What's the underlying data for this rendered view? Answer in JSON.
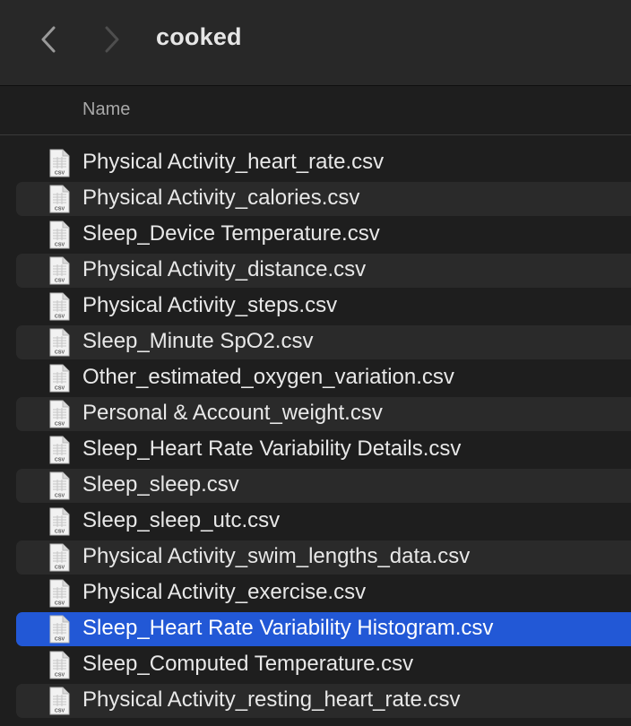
{
  "window": {
    "folder_title": "cooked"
  },
  "toolbar": {
    "back_icon": "chevron-left-icon",
    "forward_icon": "chevron-right-icon"
  },
  "columns": {
    "name_header": "Name"
  },
  "colors": {
    "background": "#1e1e1e",
    "toolbar": "#282828",
    "alt_row": "#2a2a2a",
    "selection": "#2258d6",
    "text": "#e8e8e8"
  },
  "files": [
    {
      "name": "Physical Activity_heart_rate.csv",
      "icon": "csv-file-icon",
      "selected": false
    },
    {
      "name": "Physical Activity_calories.csv",
      "icon": "csv-file-icon",
      "selected": false
    },
    {
      "name": "Sleep_Device Temperature.csv",
      "icon": "csv-file-icon",
      "selected": false
    },
    {
      "name": "Physical Activity_distance.csv",
      "icon": "csv-file-icon",
      "selected": false
    },
    {
      "name": "Physical Activity_steps.csv",
      "icon": "csv-file-icon",
      "selected": false
    },
    {
      "name": "Sleep_Minute SpO2.csv",
      "icon": "csv-file-icon",
      "selected": false
    },
    {
      "name": "Other_estimated_oxygen_variation.csv",
      "icon": "csv-file-icon",
      "selected": false
    },
    {
      "name": "Personal & Account_weight.csv",
      "icon": "csv-file-icon",
      "selected": false
    },
    {
      "name": "Sleep_Heart Rate Variability Details.csv",
      "icon": "csv-file-icon",
      "selected": false
    },
    {
      "name": "Sleep_sleep.csv",
      "icon": "csv-file-icon",
      "selected": false
    },
    {
      "name": "Sleep_sleep_utc.csv",
      "icon": "csv-file-icon",
      "selected": false
    },
    {
      "name": "Physical Activity_swim_lengths_data.csv",
      "icon": "csv-file-icon",
      "selected": false
    },
    {
      "name": "Physical Activity_exercise.csv",
      "icon": "csv-file-icon",
      "selected": false
    },
    {
      "name": "Sleep_Heart Rate Variability Histogram.csv",
      "icon": "csv-file-icon",
      "selected": true
    },
    {
      "name": "Sleep_Computed Temperature.csv",
      "icon": "csv-file-icon",
      "selected": false
    },
    {
      "name": "Physical Activity_resting_heart_rate.csv",
      "icon": "csv-file-icon",
      "selected": false
    }
  ]
}
